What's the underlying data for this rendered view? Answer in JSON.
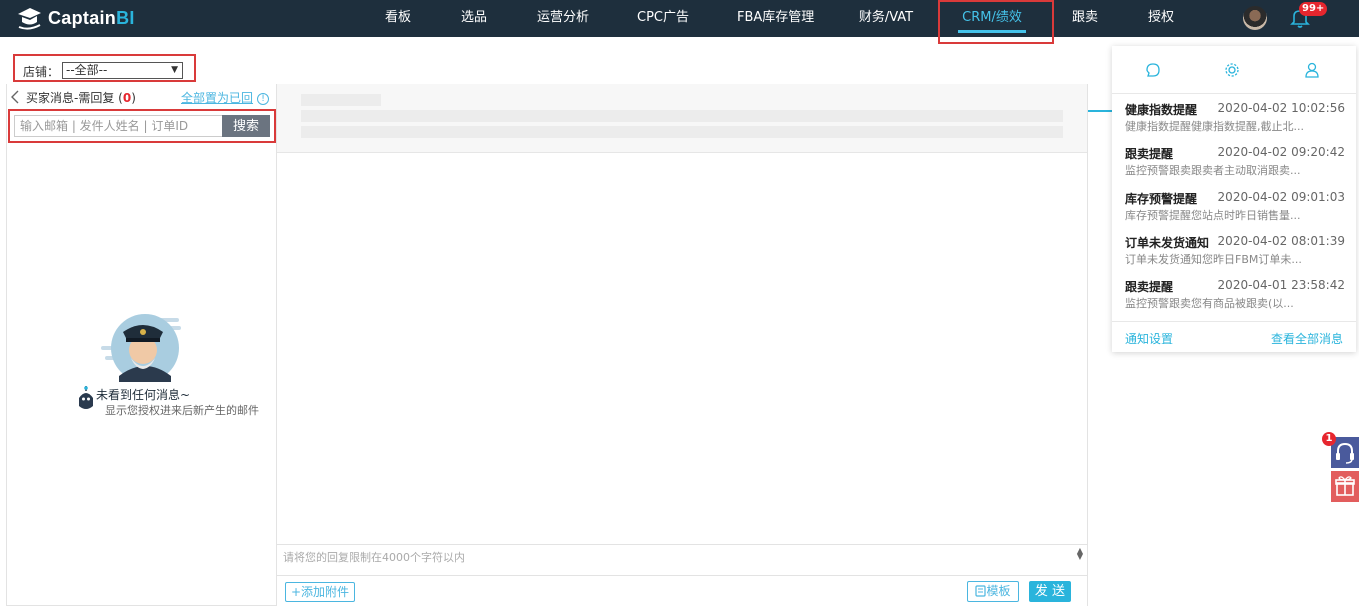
{
  "brand": {
    "name_main": "Captain",
    "name_accent": "BI"
  },
  "nav": {
    "items": [
      "看板",
      "选品",
      "运营分析",
      "CPC广告",
      "FBA库存管理",
      "财务/VAT",
      "CRM/绩效",
      "跟卖",
      "授权"
    ],
    "active": "CRM/绩效",
    "notification_count": "99+"
  },
  "store_filter": {
    "label": "店铺：",
    "value": "--全部--"
  },
  "inbox": {
    "title": "买家消息-需回复",
    "count": "0",
    "mark_all_read": "全部置为已回",
    "search_placeholder": "输入邮箱 | 发件人姓名 | 订单ID",
    "search_button": "搜索",
    "empty_title": "未看到任何消息~",
    "empty_desc": "显示您授权进来后新产生的邮件"
  },
  "reply": {
    "placeholder": "请将您的回复限制在4000个字符以内",
    "attach_button": "+添加附件",
    "template_button": "模板",
    "send_button": "发 送"
  },
  "notifications": {
    "items": [
      {
        "title": "健康指数提醒",
        "time": "2020-04-02 10:02:56",
        "body": "健康指数提醒健康指数提醒,截止北..."
      },
      {
        "title": "跟卖提醒",
        "time": "2020-04-02 09:20:42",
        "body": "监控预警跟卖跟卖者主动取消跟卖..."
      },
      {
        "title": "库存预警提醒",
        "time": "2020-04-02 09:01:03",
        "body": "库存预警提醒您站点时昨日销售量..."
      },
      {
        "title": "订单未发货通知",
        "time": "2020-04-02 08:01:39",
        "body": "订单未发货通知您昨日FBM订单未..."
      },
      {
        "title": "跟卖提醒",
        "time": "2020-04-01 23:58:42",
        "body": "监控预警跟卖您有商品被跟卖(以..."
      }
    ],
    "settings_link": "通知设置",
    "view_all_link": "查看全部消息"
  },
  "float": {
    "support_badge": "1"
  },
  "colors": {
    "nav_bg": "#1e2f3d",
    "accent": "#2ab4dc",
    "highlight": "#d93a3a",
    "badge": "#e6262e"
  }
}
